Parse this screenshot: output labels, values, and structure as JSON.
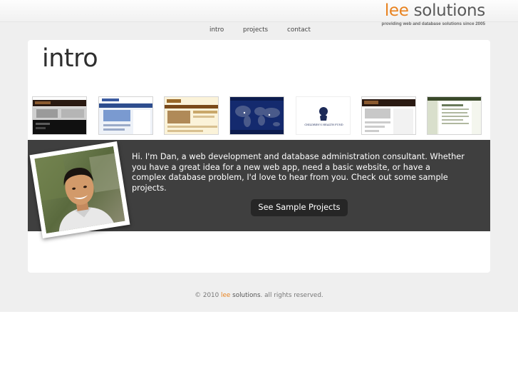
{
  "brand": {
    "name_part1": "lee",
    "name_part2": "solutions",
    "tagline": "providing web and database solutions since 2005",
    "accent_color": "#e8821f"
  },
  "nav": {
    "items": [
      {
        "label": "intro"
      },
      {
        "label": "projects"
      },
      {
        "label": "contact"
      }
    ]
  },
  "main": {
    "title": "intro",
    "thumbnails": [
      {
        "icon": "website-screenshot-dark"
      },
      {
        "icon": "website-screenshot-blue"
      },
      {
        "icon": "website-screenshot-cream"
      },
      {
        "icon": "world-map-screenshot"
      },
      {
        "icon": "childrens-logo-screenshot",
        "label": "CHILDREN'S HEALTH FUND"
      },
      {
        "icon": "website-screenshot-dark-white"
      },
      {
        "icon": "website-screenshot-green"
      }
    ],
    "intro_text": "Hi. I'm Dan, a web development and database administration consultant. Whether you have a great idea for a new web app, need a basic website, or have a complex database problem, I'd love to hear from you. Check out some sample projects.",
    "cta_label": "See Sample Projects",
    "photo_icon": "portrait-photo"
  },
  "footer": {
    "prefix": "© 2010",
    "brand_lee": "lee",
    "brand_solutions": "solutions",
    "suffix": ". all rights reserved."
  }
}
